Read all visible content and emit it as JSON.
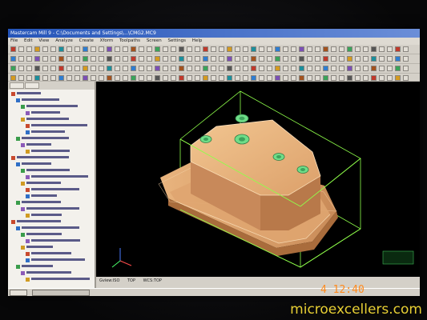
{
  "window": {
    "title": "Mastercam Mill 9 - C:\\Documents and Settings\\...\\CMG2.MC9"
  },
  "menu": [
    "File",
    "Edit",
    "View",
    "Analyze",
    "Create",
    "Xform",
    "Toolpaths",
    "Screen",
    "Settings",
    "Help"
  ],
  "viewport": {
    "status_left": "Gview:ISO",
    "status_mid": "TOP",
    "status_right": "WCS:TOP"
  },
  "overlay": {
    "camera_stamp": "4 12:40",
    "watermark": "microexcellers.com"
  },
  "colors": {
    "part_fill": "#e6b07a",
    "bounding_box": "#8fff4a",
    "hole_marker": "#6fdd88",
    "viewport_bg": "#000000",
    "watermark": "#e7cf34",
    "camera_stamp": "#ff8a1c"
  }
}
